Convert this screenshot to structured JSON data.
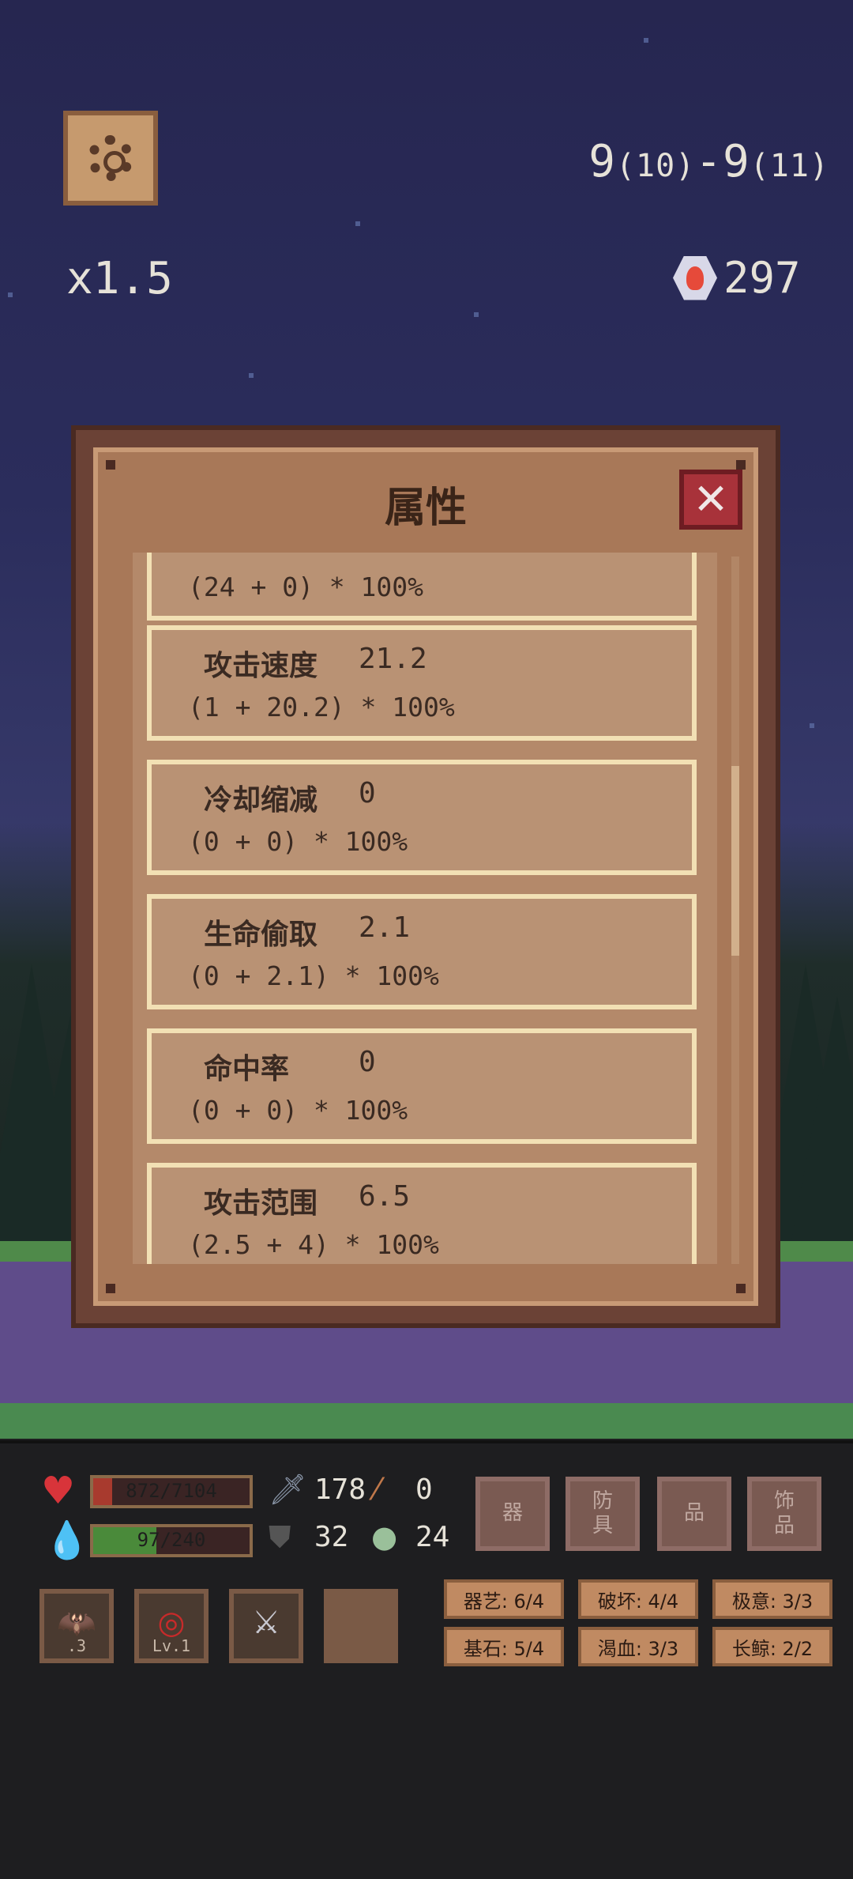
{
  "top_bar": {
    "stage_main": "9",
    "stage_sub1": "(10)",
    "stage_dash": "-",
    "stage_main2": "9",
    "stage_sub2": "(11)",
    "speed": "x1.5",
    "gem_count": "297"
  },
  "dialog": {
    "title": "属性",
    "close_label": "✕",
    "scroll_progress_percent": 35,
    "stats": [
      {
        "name": "",
        "value": "",
        "formula": "(24 + 0) * 100%"
      },
      {
        "name": "攻击速度",
        "value": "21.2",
        "formula": "(1 + 20.2) * 100%"
      },
      {
        "name": "冷却缩减",
        "value": "0",
        "formula": "(0 + 0) * 100%"
      },
      {
        "name": "生命偷取",
        "value": "2.1",
        "formula": "(0 + 2.1) * 100%"
      },
      {
        "name": "命中率",
        "value": "0",
        "formula": "(0 + 0) * 100%"
      },
      {
        "name": "攻击范围",
        "value": "6.5",
        "formula": "(2.5 + 4) * 100%"
      }
    ]
  },
  "hud": {
    "hp_text": "872/7104",
    "hp_fraction": 0.123,
    "mp_text": "97/240",
    "mp_fraction": 0.404,
    "attack": "178",
    "crit": "0",
    "armor": "32",
    "regen": "24",
    "equipment": [
      {
        "label": "器",
        "icon": "sword-icon"
      },
      {
        "label": "防\n具",
        "icon": ""
      },
      {
        "label": "品",
        "icon": "feather-icon"
      },
      {
        "label": "饰\n品",
        "icon": ""
      }
    ],
    "skills": [
      {
        "icon": "bat-icon",
        "level": ".3"
      },
      {
        "icon": "vortex-icon",
        "level": "Lv.1"
      },
      {
        "icon": "sword-icon",
        "level": ""
      },
      {
        "icon": "",
        "level": ""
      }
    ],
    "synergy_tags": [
      "器艺: 6/4",
      "破坏: 4/4",
      "极意: 3/3",
      "基石: 5/4",
      "渴血: 3/3",
      "长鲸: 2/2"
    ]
  },
  "colors": {
    "hp": "#a83a2e",
    "mp": "#4a8a3a",
    "dialog_bg": "#a87858",
    "card_border": "#f2e0b4"
  }
}
